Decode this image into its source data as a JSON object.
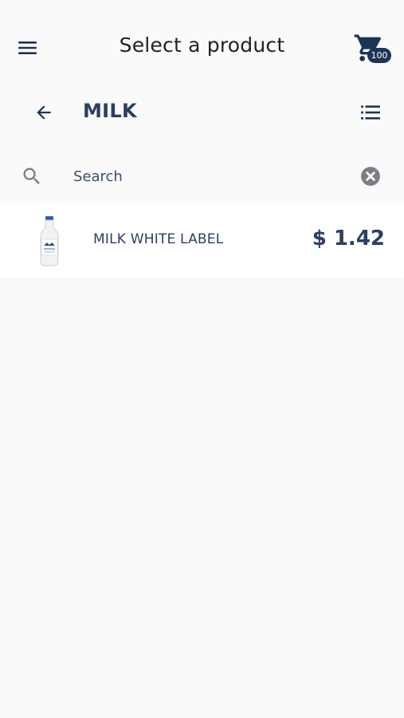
{
  "header": {
    "title": "Select a product",
    "menu_icon": "hamburger-menu-icon",
    "cart_icon": "shopping-cart-icon",
    "cart_badge": "100"
  },
  "category": {
    "back_icon": "arrow-left-icon",
    "title": "MILK",
    "view_icon": "list-view-icon"
  },
  "search": {
    "icon": "search-icon",
    "placeholder": "Search",
    "value": "",
    "clear_icon": "clear-circle-icon"
  },
  "products": [
    {
      "name": "MILK WHITE LABEL",
      "price": "$ 1.42",
      "image": "milk-bottle-image"
    }
  ],
  "colors": {
    "primary": "#1c3557",
    "text": "#2b3f60",
    "background": "#fafafa"
  }
}
